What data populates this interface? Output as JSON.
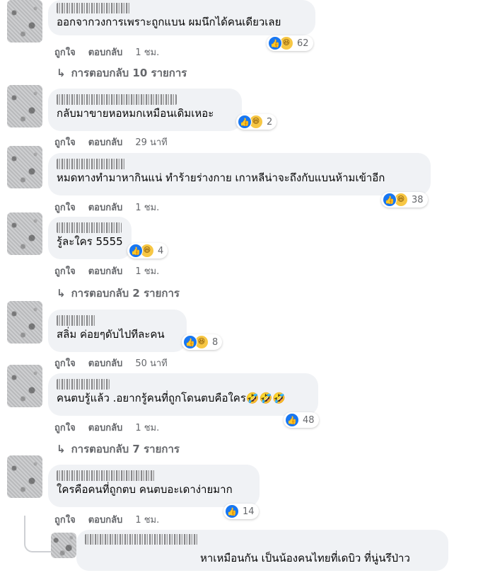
{
  "comments": [
    {
      "text": "ออกจากวงการเพราะถูกแบน ผมนึกได้คนเดียวเลย",
      "count": "62",
      "time": "1 ชม.",
      "replies": "การตอบกลับ 10 รายการ"
    },
    {
      "text": "กลับมาขายหอหมกเหมือนเดิมเหอะ",
      "count": "2",
      "time": "29 นาที"
    },
    {
      "text": "หมดทางทำมาหากินแน่ ทำร้ายร่างกาย เกาหลีน่าจะถึงกับแบนห้ามเข้าอีก",
      "count": "38",
      "time": "1 ชม."
    },
    {
      "text": "รู้ละใคร 5555",
      "count": "4",
      "time": "1 ชม.",
      "replies": "การตอบกลับ 2 รายการ"
    },
    {
      "text": "สลิ่ม ค่อยๆดับไปทีละคน",
      "count": "8",
      "time": "50 นาที"
    },
    {
      "text": "คนตบรู้แล้ว .อยากรู้คนที่ถูกโดนตบคือใคร",
      "emojis": "🤣🤣🤣",
      "count": "48",
      "time": "1 ชม.",
      "replies": "การตอบกลับ 7 รายการ"
    },
    {
      "text": "ใครคือคนที่ถูกตบ คนตบอะเดาง่ายมาก",
      "count": "14",
      "time": "1 ชม."
    }
  ],
  "reply_preview": {
    "text": "หาเหมือนกัน เป็นน้องคนไทยที่เดบิว ที่นู่นรึป่าว"
  },
  "labels": {
    "like": "ถูกใจ",
    "reply": "ตอบกลับ"
  },
  "icons": {
    "like": "like-icon",
    "haha": "haha-icon",
    "reply_arrow": "reply-arrow-icon"
  },
  "colors": {
    "bubble": "#f0f2f5",
    "like": "#1877f2",
    "haha": "#f7c744",
    "secondary_text": "#65676b"
  }
}
